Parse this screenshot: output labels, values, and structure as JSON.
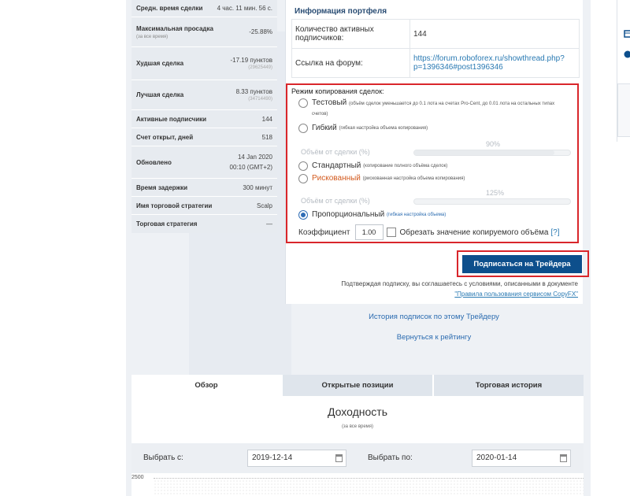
{
  "stats": [
    {
      "label": "Средн. время сделки",
      "value": "4 час. 11 мин. 56 с."
    },
    {
      "label": "Максимальная просадка",
      "sub": "(за все время)",
      "value": "-25.88%"
    },
    {
      "label": "Худшая сделка",
      "value": "-17.19 пунктов",
      "value_sub": "(29625449)"
    },
    {
      "label": "Лучшая сделка",
      "value": "8.33 пунктов",
      "value_sub": "(34714490)"
    },
    {
      "label": "Активные подписчики",
      "value": "144"
    },
    {
      "label": "Счет открыт, дней",
      "value": "518"
    },
    {
      "label": "Обновлено",
      "value": "14 Jan 2020",
      "value2": "00:10 (GMT+2)"
    },
    {
      "label": "Время задержки",
      "value": "300 минут"
    },
    {
      "label": "Имя торговой стратегии",
      "value": "Scalp"
    },
    {
      "label": "Торговая стратегия",
      "value": "—"
    }
  ],
  "portfolio": {
    "title": "Информация портфеля",
    "subscribers_label": "Количество активных подписчиков:",
    "subscribers_value": "144",
    "forum_label": "Ссылка на форум:",
    "forum_url_line1": "https://forum.roboforex.ru/showthread.php?",
    "forum_url_line2": "p=1396346#post1396346"
  },
  "copy_mode": {
    "title": "Режим копирования сделок:",
    "test_label": "Тестовый",
    "test_note": "(объём сделок уменьшается до 0.1 лота на счетах Pro-Cent, до 0.01 лота на остальных типах счетов)",
    "flex_label": "Гибкий",
    "flex_note": "(гибкая настройка объема копирования)",
    "volume_label_1": "Объём от сделки (%)",
    "volume_pct_1": "90%",
    "volume_1": 0.9,
    "standard_label": "Стандартный",
    "standard_note": "(копирование полного объёма сделок)",
    "risky_label": "Рискованный",
    "risky_note": "(рискованная настройка объема копирования)",
    "volume_label_2": "Объём от сделки (%)",
    "volume_pct_2": "125%",
    "volume_2": 0,
    "proportional_label": "Пропорциональный",
    "proportional_note": "(гибкая настройка объема)",
    "coef_label": "Коэффициент",
    "coef_value": "1.00",
    "trim_label": "Обрезать значение копируемого объёма",
    "help": "[?]",
    "selected": "proportional"
  },
  "subscribe_button": "Подписаться на Трейдера",
  "agreement_text": "Подтверждая подписку, вы соглашаетесь с условиями, описанными в документе",
  "agreement_link": "\"Правила пользования сервисом CopyFX\"",
  "history_link": "История подписок по этому Трейдеру",
  "back_link": "Вернуться к рейтингу",
  "tabs": [
    "Обзор",
    "Открытые позиции",
    "Торговая история"
  ],
  "returns": {
    "title": "Доходность",
    "subtitle": "(за все время)",
    "from_label": "Выбрать с:",
    "from_value": "2019-12-14",
    "to_label": "Выбрать по:",
    "to_value": "2020-01-14",
    "y_tick": "2500"
  },
  "colors": {
    "accent": "#0d4f8c",
    "highlight": "#d9262b",
    "risky": "#d35a1e",
    "link": "#2a7ab3"
  }
}
